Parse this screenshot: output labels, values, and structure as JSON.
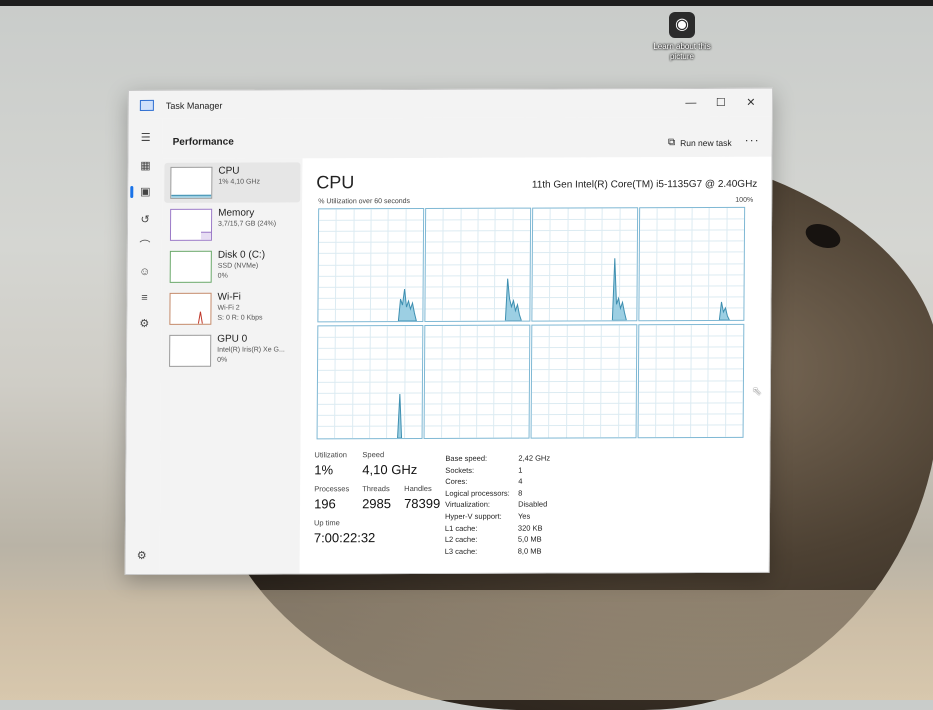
{
  "desktop": {
    "icon_label": "Learn about this picture"
  },
  "window": {
    "title": "Task Manager",
    "controls": {
      "minimize": "—",
      "maximize": "☐",
      "close": "✕"
    }
  },
  "header": {
    "section": "Performance",
    "run_new_task": "Run new task",
    "more": "···"
  },
  "devices": [
    {
      "name": "CPU",
      "sub1": "1% 4,10 GHz",
      "sub2": ""
    },
    {
      "name": "Memory",
      "sub1": "3,7/15,7 GB (24%)",
      "sub2": ""
    },
    {
      "name": "Disk 0 (C:)",
      "sub1": "SSD (NVMe)",
      "sub2": "0%"
    },
    {
      "name": "Wi-Fi",
      "sub1": "Wi-Fi 2",
      "sub2": "S: 0 R: 0 Kbps"
    },
    {
      "name": "GPU 0",
      "sub1": "Intel(R) Iris(R) Xe G...",
      "sub2": "0%"
    }
  ],
  "cpu": {
    "title": "CPU",
    "model": "11th Gen Intel(R) Core(TM) i5-1135G7 @ 2.40GHz",
    "graph_label": "% Utilization over 60 seconds",
    "graph_max": "100%",
    "stats": {
      "utilization_label": "Utilization",
      "utilization": "1%",
      "speed_label": "Speed",
      "speed": "4,10 GHz",
      "processes_label": "Processes",
      "processes": "196",
      "threads_label": "Threads",
      "threads": "2985",
      "handles_label": "Handles",
      "handles": "78399",
      "uptime_label": "Up time",
      "uptime": "7:00:22:32"
    },
    "specs": [
      {
        "k": "Base speed:",
        "v": "2,42 GHz"
      },
      {
        "k": "Sockets:",
        "v": "1"
      },
      {
        "k": "Cores:",
        "v": "4"
      },
      {
        "k": "Logical processors:",
        "v": "8"
      },
      {
        "k": "Virtualization:",
        "v": "Disabled"
      },
      {
        "k": "Hyper-V support:",
        "v": "Yes"
      },
      {
        "k": "L1 cache:",
        "v": "320 KB"
      },
      {
        "k": "L2 cache:",
        "v": "5,0 MB"
      },
      {
        "k": "L3 cache:",
        "v": "8,0 MB"
      }
    ]
  },
  "colors": {
    "cpu_line": "#3e8fb0",
    "cpu_fill": "#9ccfe3",
    "grid": "#dcebf2"
  }
}
